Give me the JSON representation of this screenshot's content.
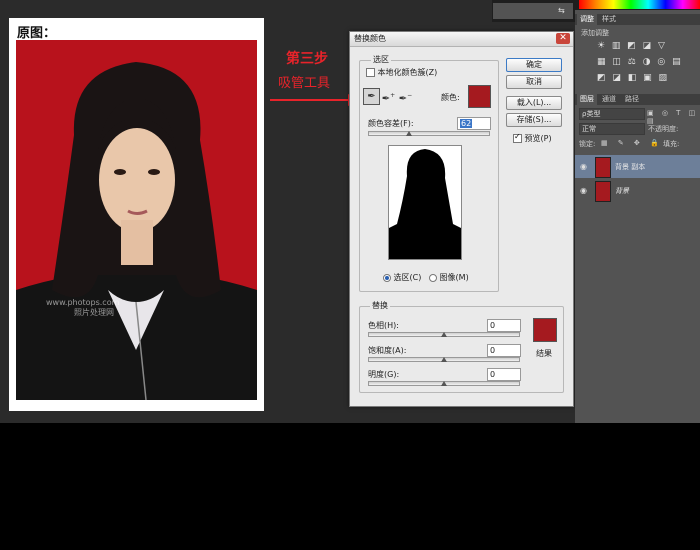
{
  "photo": {
    "title": "原图：",
    "watermark_line1": "www.photops.com",
    "watermark_line2": "照片处理网"
  },
  "annotation": {
    "step": "第三步",
    "tool": "吸管工具"
  },
  "dialog": {
    "title": "替换颜色",
    "selection_group": "选区",
    "localized_clusters": "本地化颜色簇(Z)",
    "color_label": "颜色:",
    "fuzziness_label": "颜色容差(F):",
    "fuzziness_value": "62",
    "radio_selection": "选区(C)",
    "radio_image": "图像(M)",
    "replacement_group": "替换",
    "hue_label": "色相(H):",
    "hue_value": "0",
    "saturation_label": "饱和度(A):",
    "saturation_value": "0",
    "lightness_label": "明度(G):",
    "lightness_value": "0",
    "result_label": "结果",
    "btn_ok": "确定",
    "btn_cancel": "取消",
    "btn_load": "载入(L)...",
    "btn_save": "存储(S)...",
    "preview_label": "预览(P)",
    "selected_color": "#a51a1f",
    "result_color": "#a51a1f"
  },
  "panels": {
    "adjust_tab": "调整",
    "styles_tab": "样式",
    "add_adjustment": "添加调整",
    "layers_tab": "图层",
    "channels_tab": "通道",
    "paths_tab": "路径",
    "filter_kind": "ρ类型",
    "blend_mode": "正常",
    "opacity_label": "不透明度:",
    "lock_label": "锁定:",
    "fill_label": "填充:",
    "layers": [
      {
        "name": "背景 副本",
        "selected": true
      },
      {
        "name": "背景",
        "selected": false
      }
    ]
  }
}
